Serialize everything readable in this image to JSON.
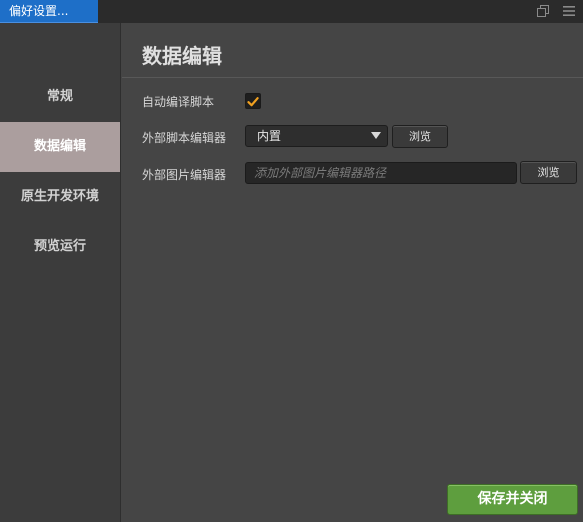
{
  "window": {
    "tab_title": "偏好设置...",
    "icons": [
      "restore-icon",
      "menu-icon"
    ]
  },
  "sidebar": {
    "items": [
      {
        "label": "常规"
      },
      {
        "label": "数据编辑",
        "active": true
      },
      {
        "label": "原生开发环境"
      },
      {
        "label": "预览运行"
      }
    ]
  },
  "main": {
    "title": "数据编辑",
    "auto_compile": {
      "label": "自动编译脚本",
      "checked": true
    },
    "script_editor": {
      "label": "外部脚本编辑器",
      "selected": "内置",
      "browse_label": "浏览"
    },
    "image_editor": {
      "label": "外部图片编辑器",
      "placeholder": "添加外部图片编辑器路径",
      "value": "",
      "browse_label": "浏览"
    }
  },
  "footer": {
    "save_label": "保存并关闭"
  },
  "colors": {
    "accent_tab": "#1e6fc8",
    "active_item": "#ab9e9e",
    "save_button": "#5e9e3e",
    "checkmark": "#f0a020"
  }
}
